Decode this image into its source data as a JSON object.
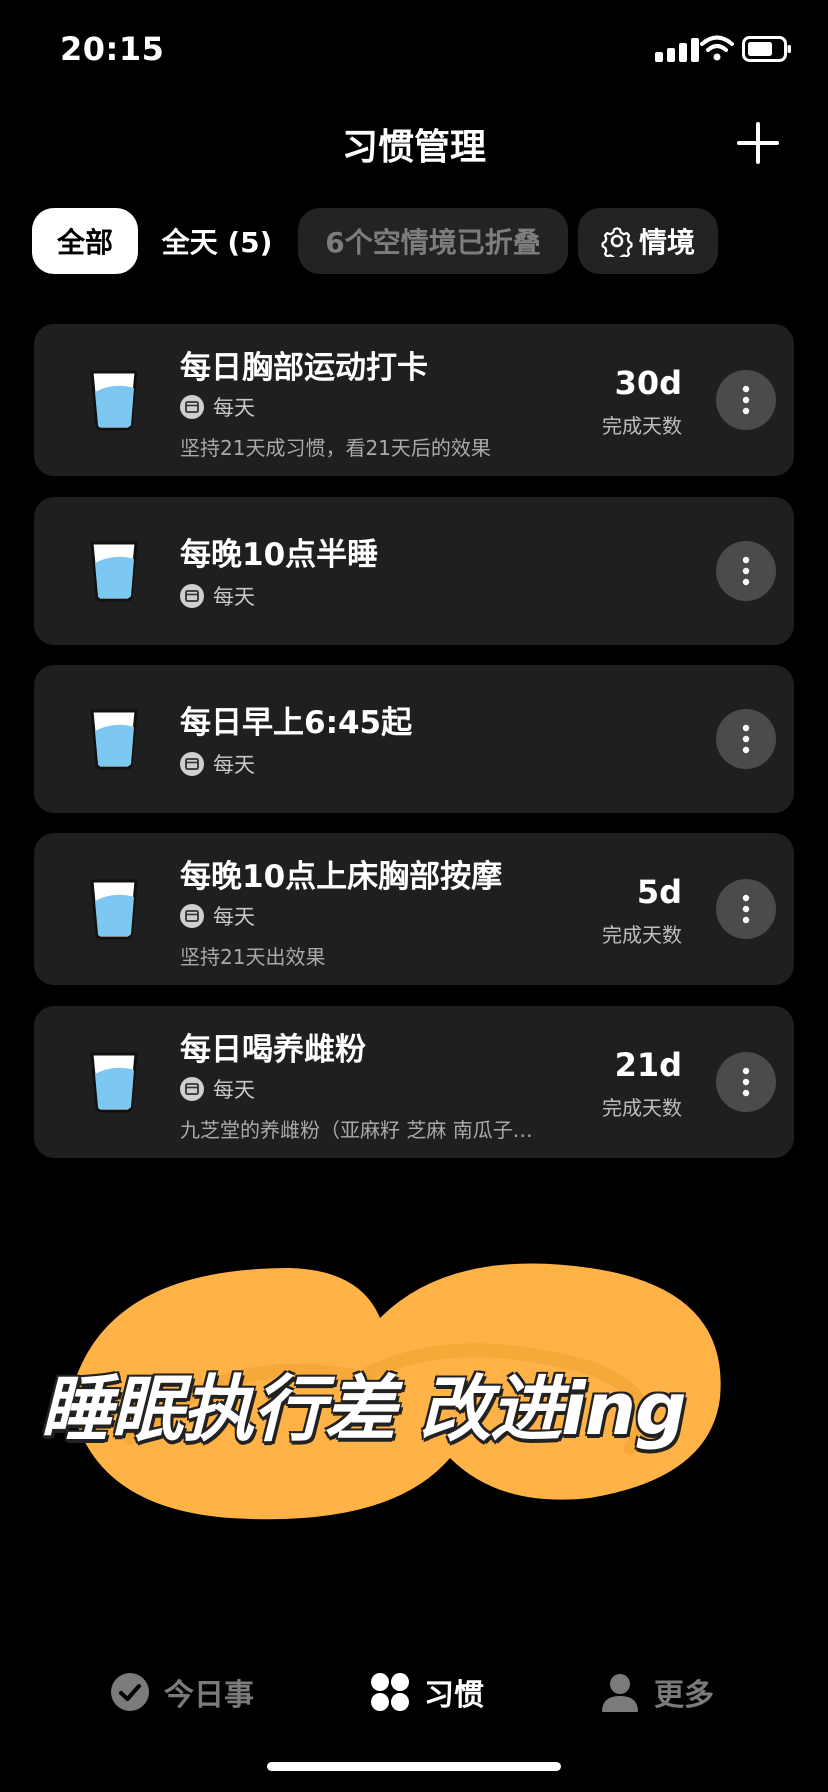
{
  "status_bar": {
    "time": "20:15"
  },
  "header": {
    "title": "习惯管理"
  },
  "tabs": [
    {
      "label": "全部"
    },
    {
      "label": "全天 (5)"
    },
    {
      "label": "6个空情境已折叠"
    },
    {
      "label": "情境"
    }
  ],
  "habits": [
    {
      "title": "每日胸部运动打卡",
      "frequency": "每天",
      "note": "坚持21天成习惯，看21天后的效果",
      "days": "30d",
      "days_label": "完成天数"
    },
    {
      "title": "每晚10点半睡",
      "frequency": "每天"
    },
    {
      "title": "每日早上6:45起",
      "frequency": "每天"
    },
    {
      "title": "每晚10点上床胸部按摩",
      "frequency": "每天",
      "note": "坚持21天出效果",
      "days": "5d",
      "days_label": "完成天数"
    },
    {
      "title": "每日喝养雌粉",
      "frequency": "每天",
      "note": "九芝堂的养雌粉（亚麻籽 芝麻 南瓜子…",
      "days": "21d",
      "days_label": "完成天数"
    }
  ],
  "banner": {
    "text": "睡眠执行差 改进ing"
  },
  "bottom_nav": [
    {
      "label": "今日事"
    },
    {
      "label": "习惯"
    },
    {
      "label": "更多"
    }
  ],
  "colors": {
    "background": "#000000",
    "card": "#1f1f1f",
    "accent_orange": "#ffb347",
    "cup_water": "#7cc8f0"
  }
}
